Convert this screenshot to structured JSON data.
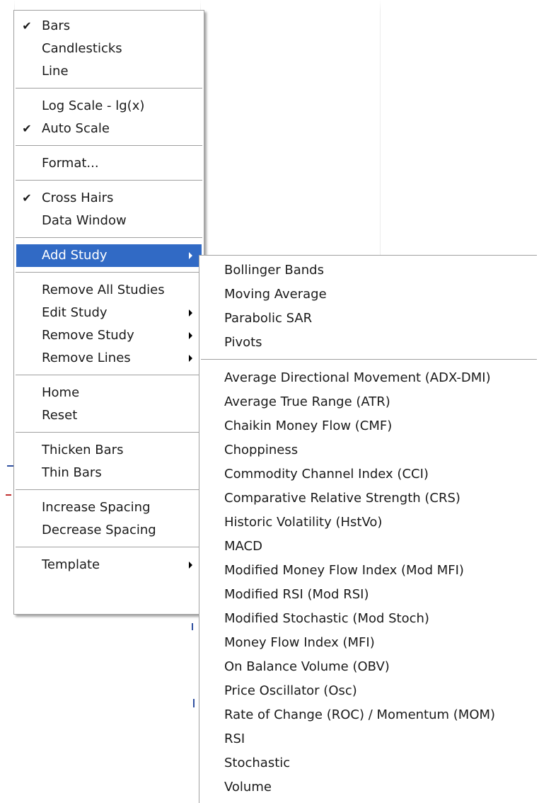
{
  "colors": {
    "highlight": "#316ac5",
    "menu_bg": "#ffffff",
    "separator": "#a0a0a0"
  },
  "main_menu": {
    "groups": [
      [
        {
          "label": "Bars",
          "checked": true
        },
        {
          "label": "Candlesticks"
        },
        {
          "label": "Line"
        }
      ],
      [
        {
          "label": "Log Scale - lg(x)"
        },
        {
          "label": "Auto Scale",
          "checked": true
        }
      ],
      [
        {
          "label": "Format..."
        }
      ],
      [
        {
          "label": "Cross Hairs",
          "checked": true
        },
        {
          "label": "Data Window"
        }
      ],
      [
        {
          "label": "Add Study",
          "submenu": true,
          "highlighted": true
        }
      ],
      [
        {
          "label": "Remove All Studies"
        },
        {
          "label": "Edit Study",
          "submenu": true
        },
        {
          "label": "Remove Study",
          "submenu": true
        },
        {
          "label": "Remove Lines",
          "submenu": true
        }
      ],
      [
        {
          "label": "Home"
        },
        {
          "label": "Reset"
        }
      ],
      [
        {
          "label": "Thicken Bars"
        },
        {
          "label": "Thin Bars"
        }
      ],
      [
        {
          "label": "Increase Spacing"
        },
        {
          "label": "Decrease Spacing"
        }
      ],
      [
        {
          "label": "Template",
          "submenu": true
        }
      ]
    ],
    "check_glyph": "✔"
  },
  "add_study_submenu": {
    "groups": [
      [
        "Bollinger Bands",
        "Moving Average",
        "Parabolic SAR",
        "Pivots"
      ],
      [
        "Average Directional Movement (ADX-DMI)",
        "Average True Range (ATR)",
        "Chaikin Money Flow (CMF)",
        "Choppiness",
        "Commodity Channel Index (CCI)",
        "Comparative Relative Strength (CRS)",
        "Historic Volatility (HstVo)",
        "MACD",
        "Modified Money Flow Index (Mod MFI)",
        "Modified RSI (Mod RSI)",
        "Modified Stochastic (Mod Stoch)",
        "Money Flow Index (MFI)",
        "On Balance Volume (OBV)",
        "Price Oscillator (Osc)",
        "Rate of Change (ROC) / Momentum (MOM)",
        "RSI",
        "Stochastic",
        "Volume"
      ]
    ]
  }
}
